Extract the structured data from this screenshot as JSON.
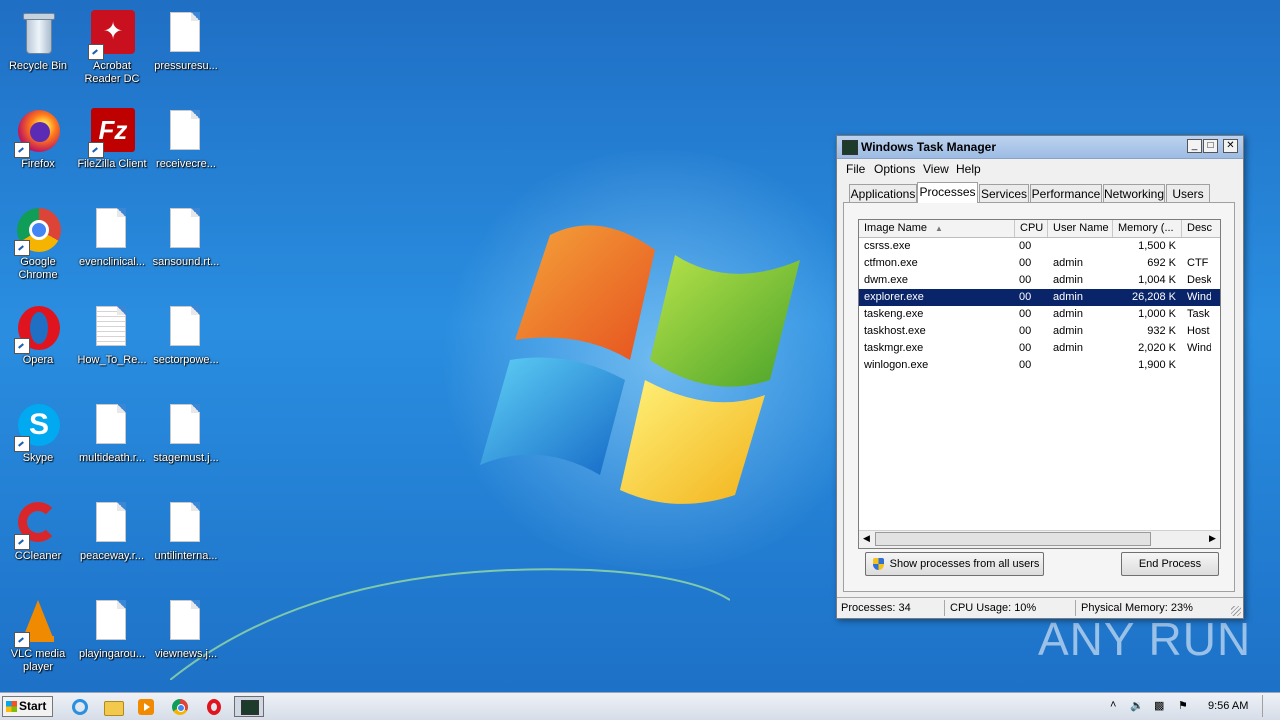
{
  "desktop": {
    "icons": [
      {
        "label": "Recycle Bin",
        "icon": "recycle-bin-icon"
      },
      {
        "label": "Acrobat Reader DC",
        "icon": "acrobat-icon"
      },
      {
        "label": "pressuresu...",
        "icon": "document-icon"
      },
      {
        "label": "Firefox",
        "icon": "firefox-icon"
      },
      {
        "label": "FileZilla Client",
        "icon": "filezilla-icon"
      },
      {
        "label": "receivecre...",
        "icon": "document-icon"
      },
      {
        "label": "Google Chrome",
        "icon": "chrome-icon"
      },
      {
        "label": "evenclinical...",
        "icon": "document-icon"
      },
      {
        "label": "sansound.rt...",
        "icon": "document-icon"
      },
      {
        "label": "Opera",
        "icon": "opera-icon"
      },
      {
        "label": "How_To_Re...",
        "icon": "text-document-icon"
      },
      {
        "label": "sectorpowe...",
        "icon": "document-icon"
      },
      {
        "label": "Skype",
        "icon": "skype-icon"
      },
      {
        "label": "multideath.r...",
        "icon": "document-icon"
      },
      {
        "label": "stagemust.j...",
        "icon": "document-icon"
      },
      {
        "label": "CCleaner",
        "icon": "ccleaner-icon"
      },
      {
        "label": "peaceway.r...",
        "icon": "document-icon"
      },
      {
        "label": "untilinterna...",
        "icon": "document-icon"
      },
      {
        "label": "VLC media player",
        "icon": "vlc-icon"
      },
      {
        "label": "playingarou...",
        "icon": "document-icon"
      },
      {
        "label": "viewnews.j...",
        "icon": "document-icon"
      }
    ],
    "watermark": "ANY RUN"
  },
  "task_manager": {
    "title": "Windows Task Manager",
    "menu": [
      "File",
      "Options",
      "View",
      "Help"
    ],
    "tabs": [
      "Applications",
      "Processes",
      "Services",
      "Performance",
      "Networking",
      "Users"
    ],
    "active_tab": "Processes",
    "columns": [
      "Image Name",
      "CPU",
      "User Name",
      "Memory (...",
      "Desc"
    ],
    "rows": [
      {
        "image": "csrss.exe",
        "cpu": "00",
        "user": "",
        "memory": "1,500 K",
        "desc": ""
      },
      {
        "image": "ctfmon.exe",
        "cpu": "00",
        "user": "admin",
        "memory": "692 K",
        "desc": "CTF I"
      },
      {
        "image": "dwm.exe",
        "cpu": "00",
        "user": "admin",
        "memory": "1,004 K",
        "desc": "Desk"
      },
      {
        "image": "explorer.exe",
        "cpu": "00",
        "user": "admin",
        "memory": "26,208 K",
        "desc": "Wind"
      },
      {
        "image": "taskeng.exe",
        "cpu": "00",
        "user": "admin",
        "memory": "1,000 K",
        "desc": "Task"
      },
      {
        "image": "taskhost.exe",
        "cpu": "00",
        "user": "admin",
        "memory": "932 K",
        "desc": "Host"
      },
      {
        "image": "taskmgr.exe",
        "cpu": "00",
        "user": "admin",
        "memory": "2,020 K",
        "desc": "Wind"
      },
      {
        "image": "winlogon.exe",
        "cpu": "00",
        "user": "",
        "memory": "1,900 K",
        "desc": ""
      }
    ],
    "selected_row": "explorer.exe",
    "show_all_button": "Show processes from all users",
    "end_process_button": "End Process",
    "status": {
      "processes": "Processes: 34",
      "cpu": "CPU Usage: 10%",
      "memory": "Physical Memory: 23%"
    }
  },
  "taskbar": {
    "start_label": "Start",
    "clock": "9:56 AM",
    "pinned": [
      "internet-explorer-icon",
      "explorer-folder-icon",
      "media-player-icon",
      "chrome-icon",
      "opera-icon",
      "task-manager-icon"
    ]
  }
}
